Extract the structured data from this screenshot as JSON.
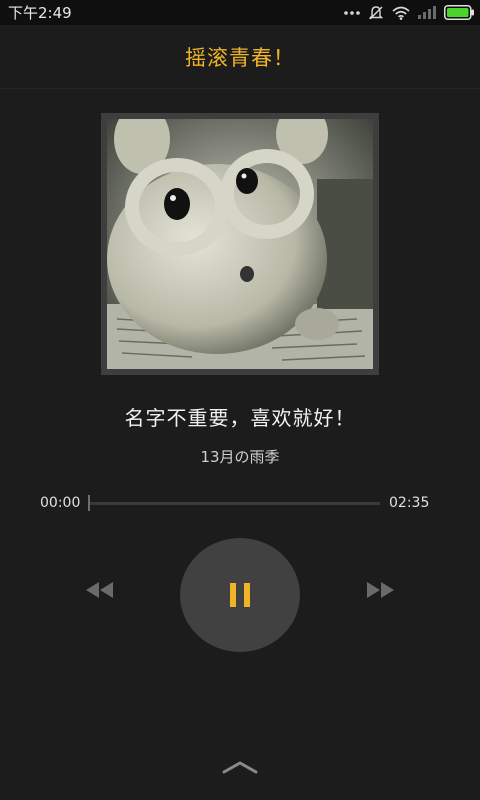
{
  "status_bar": {
    "time": "下午2:49",
    "icons": [
      "more-dots-icon",
      "notifications-muted-icon",
      "wifi-icon",
      "signal-icon",
      "battery-icon"
    ]
  },
  "header": {
    "title": "摇滚青春！"
  },
  "track": {
    "title": "名字不重要，喜欢就好！",
    "artist": "13月の雨季",
    "current_time": "00:00",
    "total_time": "02:35",
    "progress": 0.0,
    "state": "playing"
  },
  "controls": {
    "prev_icon": "rewind-icon",
    "play_pause_icon": "pause-icon",
    "next_icon": "fast-forward-icon",
    "expand_icon": "chevron-up-icon"
  },
  "colors": {
    "accent": "#f0b428",
    "background": "#1c1c1c",
    "status_bar": "#0f0f0f",
    "button_bg": "#414141",
    "battery": "#4cd42e"
  }
}
